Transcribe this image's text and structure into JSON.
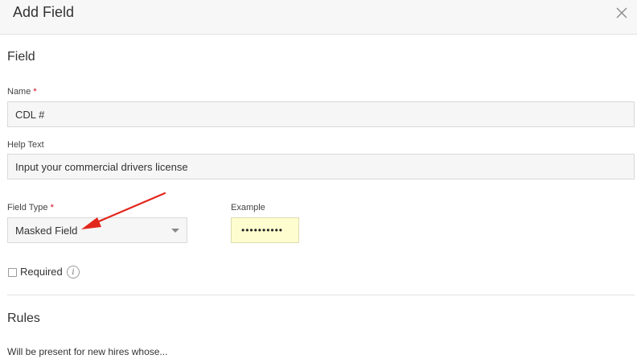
{
  "modal": {
    "title": "Add Field"
  },
  "field_section": {
    "title": "Field",
    "name": {
      "label": "Name",
      "required_mark": "*",
      "value": "CDL #"
    },
    "help_text": {
      "label": "Help Text",
      "value": "Input your commercial drivers license"
    },
    "field_type": {
      "label": "Field Type",
      "required_mark": "*",
      "selected": "Masked Field"
    },
    "example": {
      "label": "Example",
      "value": "••••••••••"
    },
    "required": {
      "label": "Required",
      "checked": false
    }
  },
  "rules_section": {
    "title": "Rules",
    "text": "Will be present for new hires whose..."
  },
  "icons": {
    "close": "close-icon",
    "dropdown": "chevron-down-icon",
    "info": "info-icon",
    "annotation": "red-arrow"
  },
  "colors": {
    "header_bg": "#f7f7f7",
    "required_mark": "#d0021b",
    "example_bg": "#fdfdcf",
    "annotation_arrow": "#e3261c"
  }
}
